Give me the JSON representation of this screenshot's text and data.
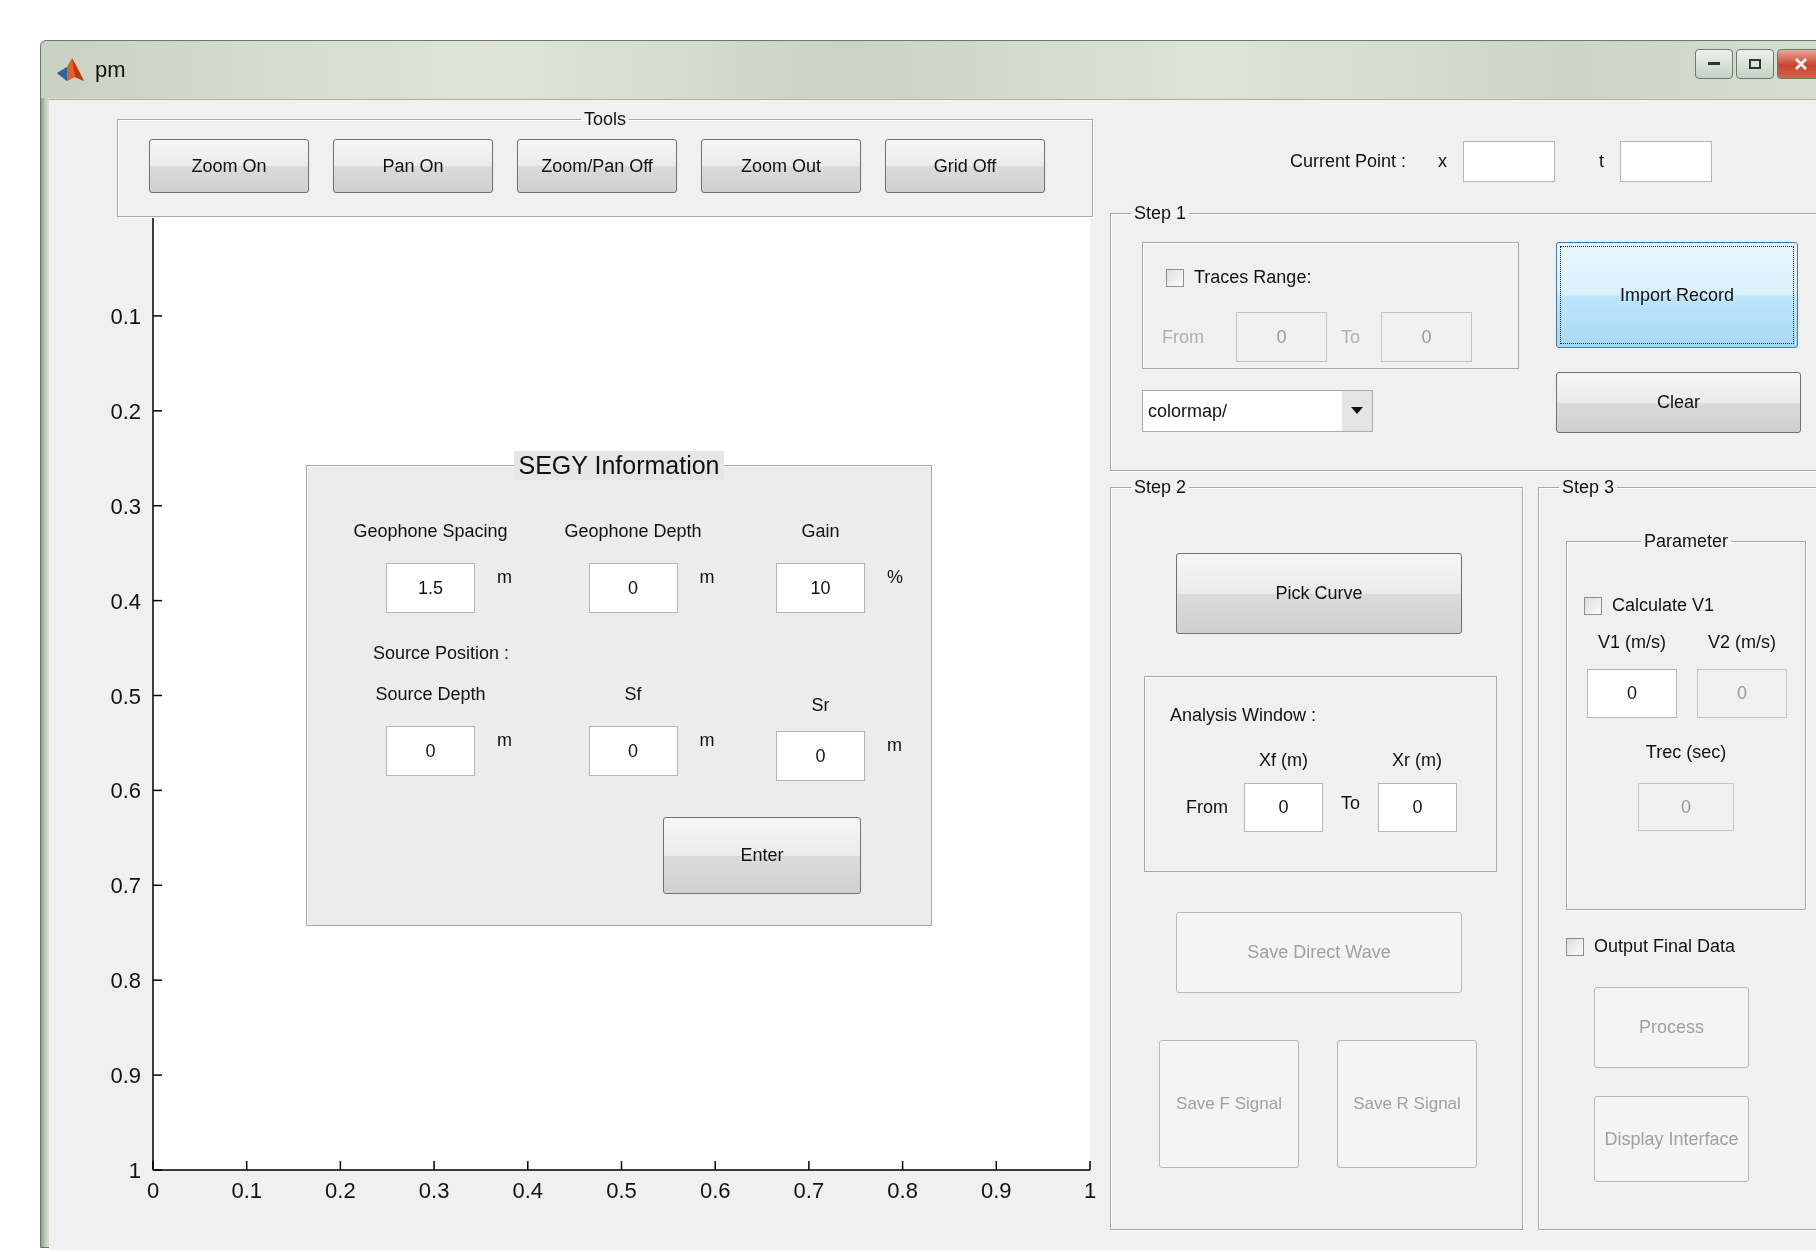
{
  "window": {
    "title": "pm"
  },
  "tools": {
    "title": "Tools",
    "buttons": [
      {
        "label": "Zoom On"
      },
      {
        "label": "Pan On"
      },
      {
        "label": "Zoom/Pan Off"
      },
      {
        "label": "Zoom Out"
      },
      {
        "label": "Grid Off"
      }
    ]
  },
  "axes": {
    "yticks": [
      "0.1",
      "0.2",
      "0.3",
      "0.4",
      "0.5",
      "0.6",
      "0.7",
      "0.8",
      "0.9",
      "1"
    ],
    "xticks": [
      "0",
      "0.1",
      "0.2",
      "0.3",
      "0.4",
      "0.5",
      "0.6",
      "0.7",
      "0.8",
      "0.9",
      "1"
    ]
  },
  "segy_information": {
    "title": "SEGY Information",
    "fields": [
      {
        "label": "Geophone Spacing",
        "value": "1.5",
        "unit": "m"
      },
      {
        "label": "Geophone Depth",
        "value": "0",
        "unit": "m"
      },
      {
        "label": "Gain",
        "value": "10",
        "unit": "%"
      }
    ],
    "section_label": "Source Position :",
    "source_fields": [
      {
        "label": "Source Depth",
        "value": "0",
        "unit": "m"
      },
      {
        "label": "Sf",
        "value": "0",
        "unit": "m"
      },
      {
        "label": "Sr",
        "value": "0",
        "unit": "m"
      }
    ],
    "button": "Enter"
  },
  "current_point": {
    "label": "Current Point :",
    "fields": [
      {
        "label": "x"
      },
      {
        "label": "t"
      }
    ]
  },
  "step1": {
    "title": "Step 1",
    "traces_range": {
      "label": "Traces Range:",
      "checked": false,
      "disabled": true,
      "from_label": "From",
      "from_value": "0",
      "to_label": "To",
      "to_value": "0"
    },
    "colormap": {
      "value": "colormap/"
    },
    "buttons": [
      {
        "label": "Import Record",
        "focused": true
      },
      {
        "label": "Clear",
        "focused": false
      }
    ]
  },
  "step2": {
    "title": "Step 2",
    "pick_button": {
      "label": "Pick Curve",
      "disabled": false
    },
    "analysis_window": {
      "title": "Analysis Window :",
      "columns": [
        "Xf (m)",
        "Xr (m)"
      ],
      "from_label": "From",
      "from_value": "0",
      "to_label": "To",
      "to_value": "0"
    },
    "save_direct_button": {
      "label": "Save Direct Wave",
      "disabled": true
    },
    "signal_buttons": [
      {
        "label": "Save F Signal",
        "disabled": true
      },
      {
        "label": "Save R Signal",
        "disabled": true
      }
    ]
  },
  "step3": {
    "title": "Step 3",
    "parameter": {
      "title": "Parameter",
      "calculate": {
        "label": "Calculate V1",
        "checked": false
      },
      "fields": [
        {
          "label": "V1 (m/s)",
          "value": "0",
          "disabled": false
        },
        {
          "label": "V2 (m/s)",
          "value": "0",
          "disabled": true
        }
      ],
      "trec": {
        "label": "Trec (sec)",
        "value": "0",
        "disabled": true
      }
    },
    "output": {
      "label": "Output Final Data",
      "checked": false
    },
    "buttons": [
      {
        "label": "Process",
        "disabled": true
      },
      {
        "label": "Display Interface",
        "disabled": true
      }
    ]
  }
}
